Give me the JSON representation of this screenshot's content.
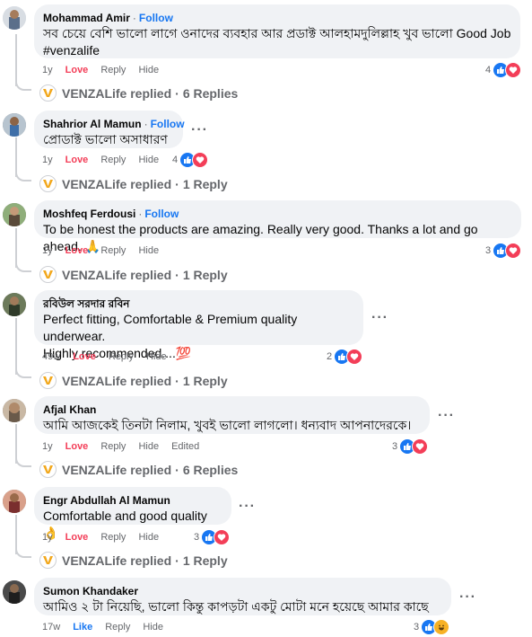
{
  "comments": [
    {
      "author": "Mohammad Amir",
      "follow": "Follow",
      "text": "সব চেয়ে বেশি ভালো লাগে ওনাদের ব্যবহার আর প্রডাক্ট আলহামদুলিল্লাহ খুব ভালো Good Job",
      "hashtag": "#venzalife",
      "time": "1y",
      "reaction_label": "Love",
      "reply_label": "Reply",
      "hide_label": "Hide",
      "react_count": "4",
      "reply_author": "VENZALife replied",
      "reply_count": "6 Replies"
    },
    {
      "author": "Shahrior Al Mamun",
      "follow": "Follow",
      "text": "প্রোডাক্ট ভালো অসাধারণ",
      "time": "1y",
      "reaction_label": "Love",
      "reply_label": "Reply",
      "hide_label": "Hide",
      "react_count": "4",
      "reply_author": "VENZALife replied",
      "reply_count": "1 Reply"
    },
    {
      "author": "Moshfeq Ferdousi",
      "follow": "Follow",
      "text": "To be honest the products are amazing. Really very good. Thanks a lot and go ahead. 🙏",
      "time": "1y",
      "reaction_label": "Love",
      "reply_label": "Reply",
      "hide_label": "Hide",
      "react_count": "3",
      "reply_author": "VENZALife replied",
      "reply_count": "1 Reply"
    },
    {
      "author": "রবিউল সরদার রবিন",
      "text_line1": "Perfect fitting, Comfortable & Premium quality underwear.",
      "text_line2": "Highly recommended....💯",
      "time": "49w",
      "reaction_label": "Love",
      "reply_label": "Reply",
      "hide_label": "Hide",
      "react_count": "2",
      "reply_author": "VENZALife replied",
      "reply_count": "1 Reply"
    },
    {
      "author": "Afjal Khan",
      "text": "আমি আজকেই তিনটা নিলাম, খুবই ভালো লাগলো। ধন্যবাদ আপনাদেরকে।",
      "time": "1y",
      "reaction_label": "Love",
      "reply_label": "Reply",
      "hide_label": "Hide",
      "edited_label": "Edited",
      "react_count": "3",
      "reply_author": "VENZALife replied",
      "reply_count": "6 Replies"
    },
    {
      "author": "Engr Abdullah Al Mamun",
      "text": "Comfortable and good quality 👌",
      "time": "1y",
      "reaction_label": "Love",
      "reply_label": "Reply",
      "hide_label": "Hide",
      "react_count": "3",
      "reply_author": "VENZALife replied",
      "reply_count": "1 Reply"
    },
    {
      "author": "Sumon Khandaker",
      "text": "আমিও ২ টা নিয়েছি, ভালো কিন্তু কাপড়টা একটু মোটা মনে হয়েছে আমার কাছে",
      "time": "17w",
      "reaction_label": "Like",
      "reply_label": "Reply",
      "hide_label": "Hide",
      "react_count": "3"
    }
  ],
  "separator": "·",
  "more_icon": "more-dots-icon",
  "colors": {
    "like": "#1877f2",
    "love": "#f33e58",
    "link": "#1877f2",
    "bubble": "#f0f2f5",
    "muted": "#65676b"
  }
}
